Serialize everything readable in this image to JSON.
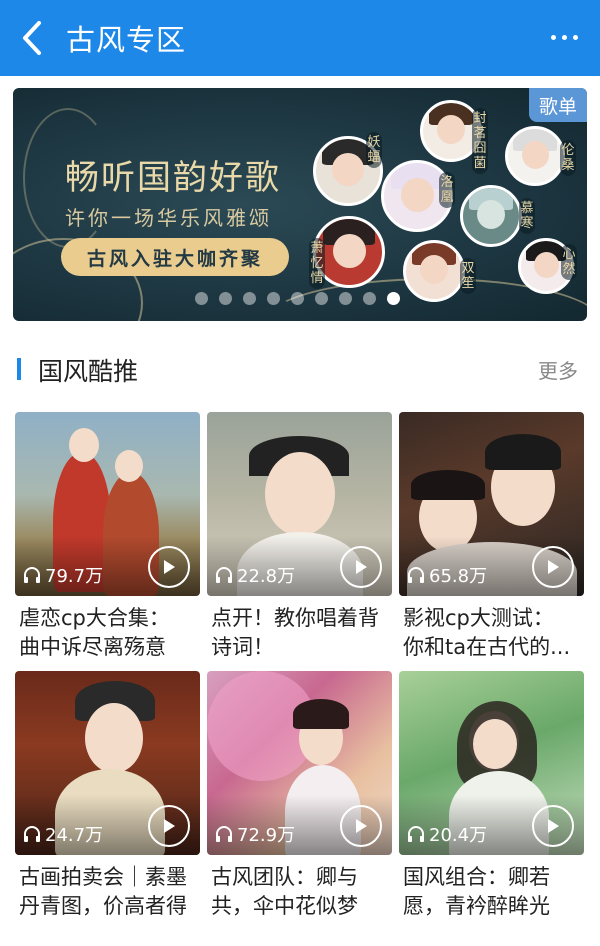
{
  "header": {
    "title": "古风专区",
    "back_icon": "chevron-left-icon",
    "more_icon": "more-horizontal-icon"
  },
  "banner": {
    "title": "畅听国韵好歌",
    "subtitle": "许你一场华乐风雅颂",
    "pill": "古风入驻大咖齐聚",
    "tag": "歌单",
    "artists": [
      "妖蝠",
      "封茗囧菌",
      "伦桑",
      "洛凰",
      "慕寒",
      "萧忆情",
      "双笙",
      "心然"
    ],
    "slides_total": 9,
    "slides_active": 9
  },
  "section": {
    "title": "国风酷推",
    "more": "更多"
  },
  "cards": [
    {
      "count": "79.7万",
      "line1": "虐恋cp大合集：",
      "line2": "曲中诉尽离殇意"
    },
    {
      "count": "22.8万",
      "line1": "点开！教你唱着背",
      "line2": "诗词！"
    },
    {
      "count": "65.8万",
      "line1": "影视cp大测试：",
      "line2": "你和ta在古代的..."
    },
    {
      "count": "24.7万",
      "line1": "古画拍卖会｜素墨",
      "line2": "丹青图，价高者得"
    },
    {
      "count": "72.9万",
      "line1": "古风团队：卿与",
      "line2": "共，伞中花似梦"
    },
    {
      "count": "20.4万",
      "line1": "国风组合：卿若",
      "line2": "愿，青衿醉眸光"
    }
  ],
  "colors": {
    "header_bg": "#1e88e8",
    "accent": "#1e88e8",
    "banner_bg": "#1c3540",
    "banner_gold": "#e9cc8e",
    "tag_bg": "#5b96d6"
  }
}
